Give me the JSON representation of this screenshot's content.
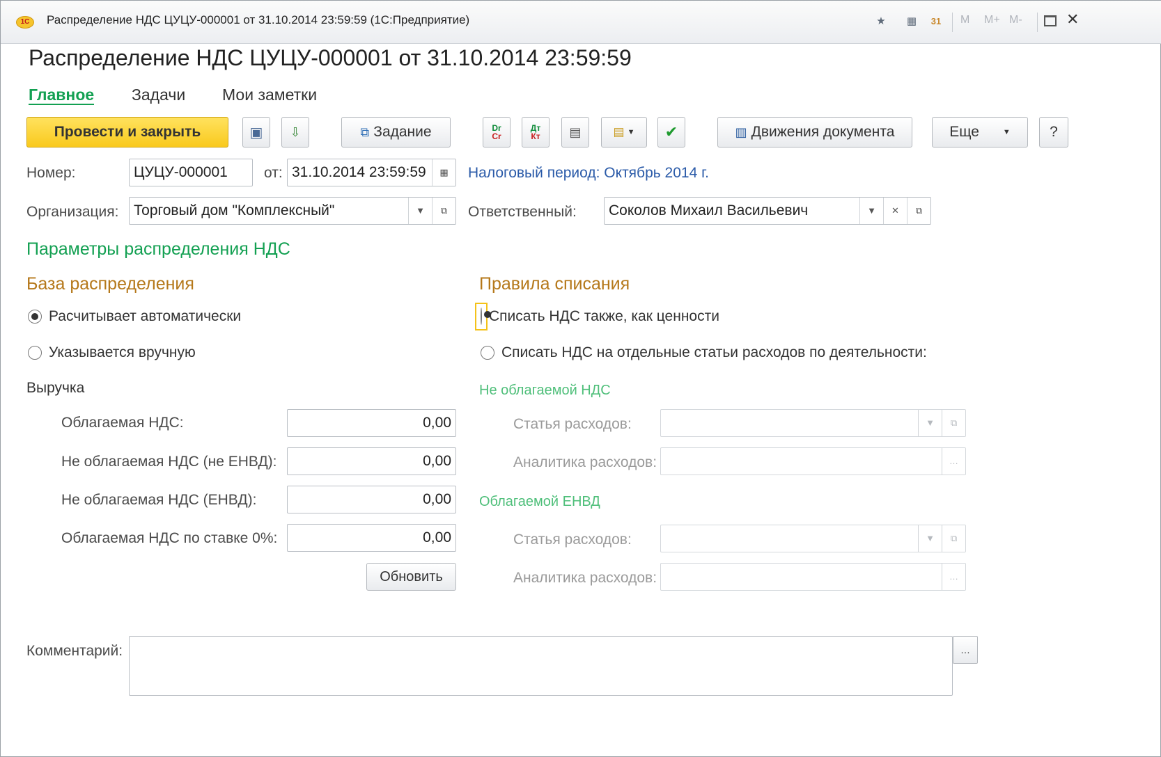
{
  "window": {
    "title": "Распределение НДС ЦУЦУ-000001 от 31.10.2014 23:59:59  (1С:Предприятие)",
    "logo_text": "1С",
    "memory_buttons": [
      "M",
      "M+",
      "M-"
    ]
  },
  "header": {
    "title": "Распределение НДС ЦУЦУ-000001 от 31.10.2014 23:59:59"
  },
  "tabs": [
    {
      "label": "Главное",
      "active": true
    },
    {
      "label": "Задачи",
      "active": false
    },
    {
      "label": "Мои заметки",
      "active": false
    }
  ],
  "toolbar": {
    "post_close_label": "Провести и закрыть",
    "task_label": "Задание",
    "movements_label": "Движения документа",
    "more_label": "Еще",
    "help_label": "?"
  },
  "form": {
    "number_label": "Номер:",
    "number_value": "ЦУЦУ-000001",
    "date_label": "от:",
    "date_value": "31.10.2014 23:59:59",
    "tax_period_link": "Налоговый период: Октябрь 2014 г.",
    "org_label": "Организация:",
    "org_value": "Торговый дом \"Комплексный\"",
    "resp_label": "Ответственный:",
    "resp_value": "Соколов Михаил Васильевич"
  },
  "params": {
    "group_title": "Параметры распределения НДС",
    "base": {
      "title": "База распределения",
      "options": [
        {
          "label": "Расчитывает автоматически",
          "selected": true
        },
        {
          "label": "Указывается вручную",
          "selected": false
        }
      ],
      "revenue_label": "Выручка",
      "rows": [
        {
          "label": "Облагаемая НДС:",
          "value": "0,00"
        },
        {
          "label": "Не облагаемая НДС (не ЕНВД):",
          "value": "0,00"
        },
        {
          "label": "Не облагаемая НДС (ЕНВД):",
          "value": "0,00"
        },
        {
          "label": "Облагаемая НДС по ставке 0%:",
          "value": "0,00"
        }
      ],
      "refresh_label": "Обновить"
    },
    "rules": {
      "title": "Правила списания",
      "options": [
        {
          "label": "Списать НДС также, как ценности",
          "selected": true
        },
        {
          "label": "Списать НДС на отдельные статьи расходов по деятельности:",
          "selected": false
        }
      ],
      "sections": [
        {
          "title": "Не облагаемой НДС",
          "expense_item_label": "Статья расходов:",
          "expense_analytics_label": "Аналитика расходов:"
        },
        {
          "title": "Облагаемой ЕНВД",
          "expense_item_label": "Статья расходов:",
          "expense_analytics_label": "Аналитика расходов:"
        }
      ]
    }
  },
  "comment": {
    "label": "Комментарий:",
    "value": ""
  },
  "colors": {
    "accent_green": "#13a052",
    "section_orange": "#b5781a",
    "primary_button": "#f9c91d",
    "link_blue": "#2a5aa8"
  }
}
